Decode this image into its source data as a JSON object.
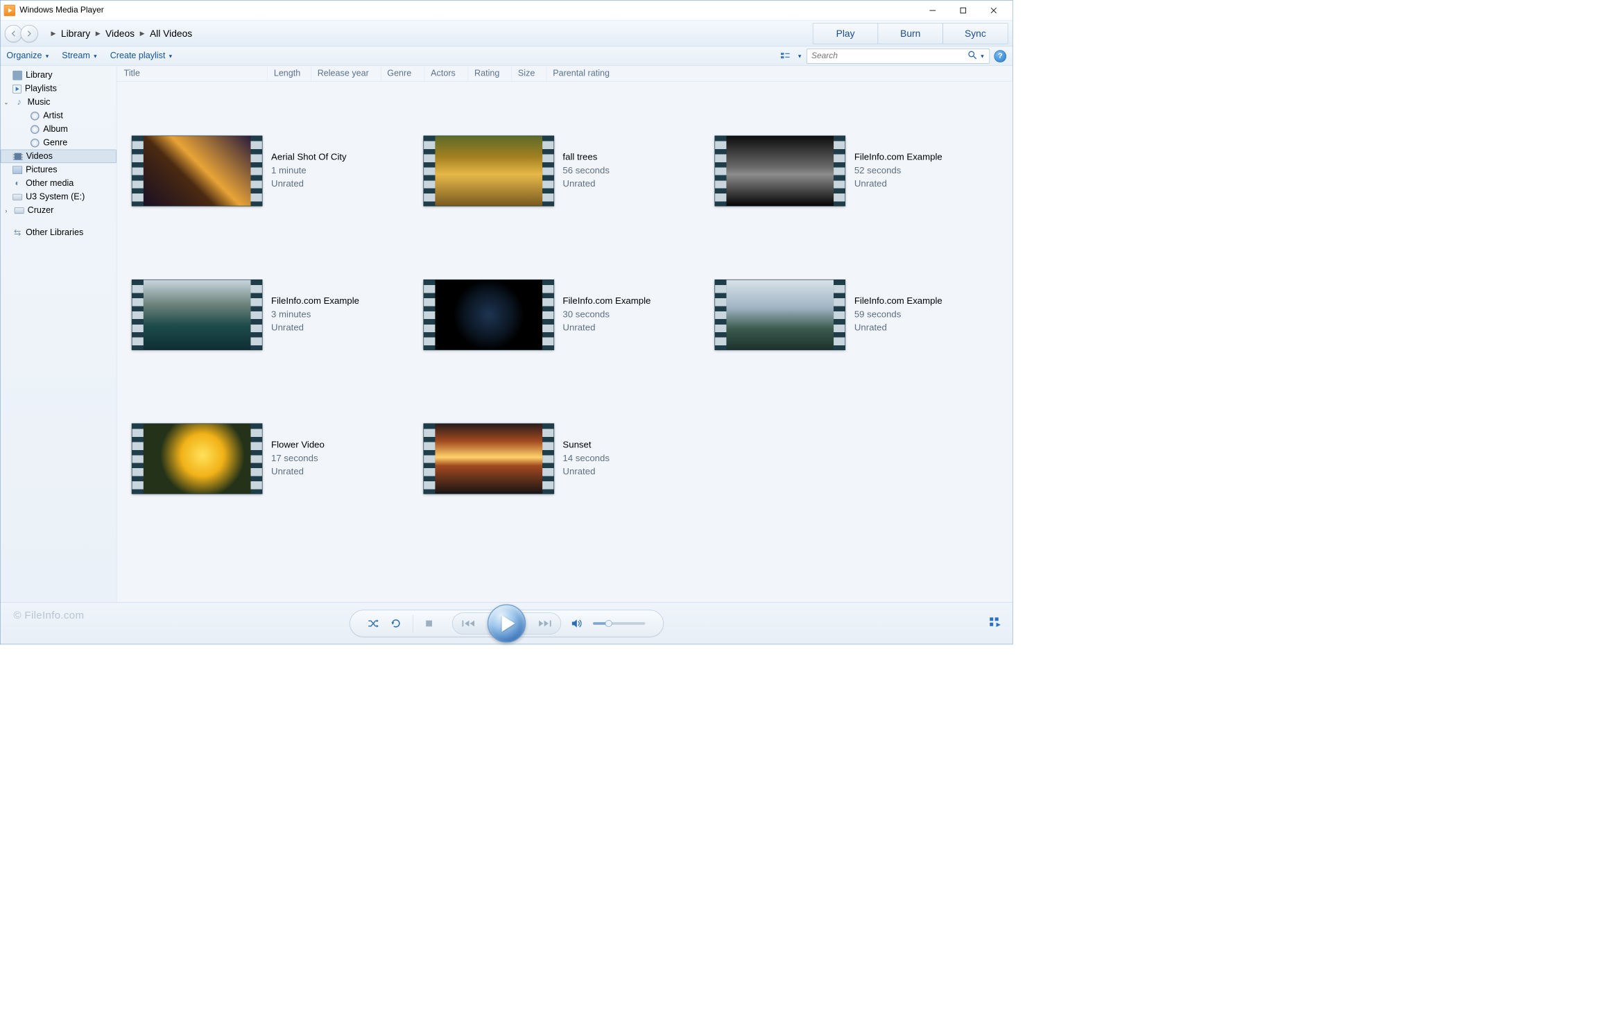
{
  "window": {
    "title": "Windows Media Player"
  },
  "nav": {
    "breadcrumbs": [
      "Library",
      "Videos",
      "All Videos"
    ]
  },
  "mode_tabs": {
    "play": "Play",
    "burn": "Burn",
    "sync": "Sync"
  },
  "toolbar": {
    "organize": "Organize",
    "stream": "Stream",
    "create_playlist": "Create playlist",
    "search_placeholder": "Search"
  },
  "sidebar": [
    {
      "label": "Library",
      "level": 0,
      "icon": "library-icon"
    },
    {
      "label": "Playlists",
      "level": 1,
      "icon": "playlist-icon"
    },
    {
      "label": "Music",
      "level": 1,
      "icon": "music-icon",
      "expanded": true
    },
    {
      "label": "Artist",
      "level": 2,
      "icon": "disc-icon"
    },
    {
      "label": "Album",
      "level": 2,
      "icon": "disc-icon"
    },
    {
      "label": "Genre",
      "level": 2,
      "icon": "disc-icon"
    },
    {
      "label": "Videos",
      "level": 1,
      "icon": "video-icon",
      "selected": true
    },
    {
      "label": "Pictures",
      "level": 1,
      "icon": "picture-icon"
    },
    {
      "label": "Other media",
      "level": 1,
      "icon": "other-media-icon"
    },
    {
      "label": "U3 System (E:)",
      "level": 1,
      "icon": "drive-icon"
    },
    {
      "label": "Cruzer",
      "level": 1,
      "icon": "drive-icon",
      "collapsible": true
    },
    {
      "label": "Other Libraries",
      "level": 0,
      "icon": "other-libraries-icon",
      "gap": true
    }
  ],
  "columns": {
    "title": "Title",
    "length": "Length",
    "release_year": "Release year",
    "genre": "Genre",
    "actors": "Actors",
    "rating": "Rating",
    "size": "Size",
    "parental": "Parental rating"
  },
  "videos": [
    {
      "title": "Aerial Shot Of City",
      "length": "1 minute",
      "rating": "Unrated",
      "bg": "bg-city"
    },
    {
      "title": "fall trees",
      "length": "56 seconds",
      "rating": "Unrated",
      "bg": "bg-trees"
    },
    {
      "title": "FileInfo.com Example",
      "length": "52 seconds",
      "rating": "Unrated",
      "bg": "bg-dark1"
    },
    {
      "title": "FileInfo.com Example",
      "length": "3 minutes",
      "rating": "Unrated",
      "bg": "bg-bay"
    },
    {
      "title": "FileInfo.com Example",
      "length": "30 seconds",
      "rating": "Unrated",
      "bg": "bg-earth"
    },
    {
      "title": "FileInfo.com Example",
      "length": "59 seconds",
      "rating": "Unrated",
      "bg": "bg-mtn"
    },
    {
      "title": "Flower Video",
      "length": "17 seconds",
      "rating": "Unrated",
      "bg": "bg-flower"
    },
    {
      "title": "Sunset",
      "length": "14 seconds",
      "rating": "Unrated",
      "bg": "bg-sunset"
    }
  ],
  "watermark": "© FileInfo.com"
}
